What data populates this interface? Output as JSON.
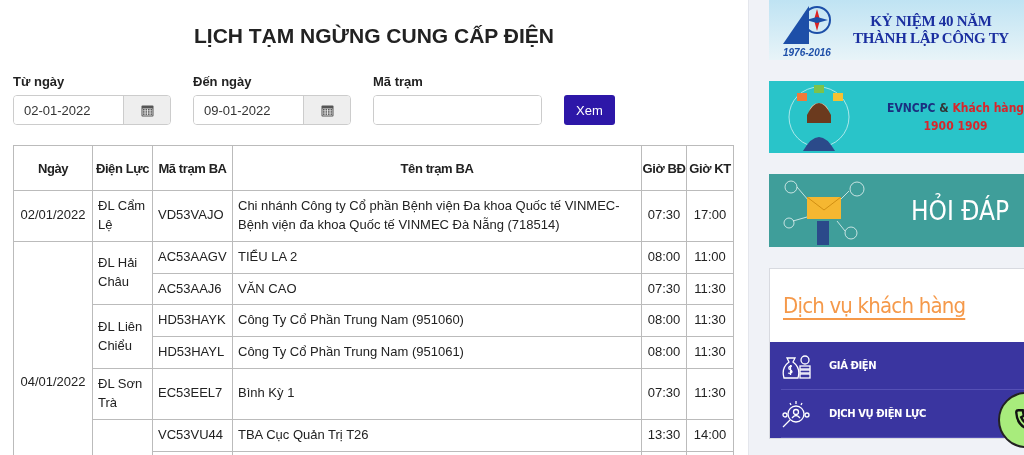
{
  "title": "LỊCH TẠM NGỪNG CUNG CẤP ĐIỆN",
  "filters": [
    {
      "kind": "date",
      "label": "Từ ngày",
      "value": "02-01-2022"
    },
    {
      "kind": "date",
      "label": "Đến ngày",
      "value": "09-01-2022"
    },
    {
      "kind": "text",
      "label": "Mã trạm"
    }
  ],
  "submit_button": "Xem",
  "table": {
    "columns": [
      "Ngày",
      "Điện Lực",
      "Mã trạm BA",
      "Tên trạm BA",
      "Giờ BĐ",
      "Giờ KT"
    ],
    "groups": [
      {
        "date": "02/01/2022",
        "units": [
          {
            "name": "ĐL Cẩm Lệ",
            "stations": [
              {
                "code": "VD53VAJO",
                "name": "Chi nhánh Công ty Cổ phần Bệnh viện Đa khoa Quốc tế VINMEC-Bệnh viện đa khoa Quốc tế VINMEC Đà Nẵng (718514)",
                "start": "07:30",
                "end": "17:00"
              }
            ]
          }
        ]
      },
      {
        "date": "04/01/2022",
        "units": [
          {
            "name": "ĐL Hải Châu",
            "stations": [
              {
                "code": "AC53AAGV",
                "name": "TIỂU LA 2",
                "start": "08:00",
                "end": "11:00"
              },
              {
                "code": "AC53AAJ6",
                "name": "VĂN CAO",
                "start": "07:30",
                "end": "11:30"
              }
            ]
          },
          {
            "name": "ĐL Liên Chiểu",
            "stations": [
              {
                "code": "HD53HAYK",
                "name": "Công Ty Cổ Phần Trung Nam (951060)",
                "start": "08:00",
                "end": "11:30"
              },
              {
                "code": "HD53HAYL",
                "name": "Công Ty Cổ Phần Trung Nam (951061)",
                "start": "08:00",
                "end": "11:30"
              }
            ]
          },
          {
            "name": "ĐL Sơn Trà",
            "stations": [
              {
                "code": "EC53EEL7",
                "name": "Bình Kỳ 1",
                "start": "07:30",
                "end": "11:30"
              }
            ]
          },
          {
            "stations": [
              {
                "code": "VC53VU44",
                "name": "TBA Cục Quản Trị T26",
                "start": "13:30",
                "end": "14:00"
              }
            ]
          }
        ]
      }
    ]
  },
  "sidebar": {
    "banners": [
      {
        "kind": "anniversary",
        "lines": [
          "KỶ NIỆM 40 NĂM",
          "THÀNH LẬP CÔNG TY"
        ],
        "years": "1976-2016"
      },
      {
        "kind": "hotline",
        "brand": "EVNCPC",
        "amp": "&",
        "audience": "Khách hàng",
        "phone": "1900 1909"
      },
      {
        "kind": "faq",
        "text": "HỎI ĐÁP"
      }
    ],
    "service_card": {
      "title": "Dịch vụ khách hàng",
      "items": [
        {
          "kind": "price",
          "label": "GIÁ ĐIỆN"
        },
        {
          "kind": "search",
          "label": "DỊCH VỤ ĐIỆN LỰC"
        }
      ]
    }
  }
}
